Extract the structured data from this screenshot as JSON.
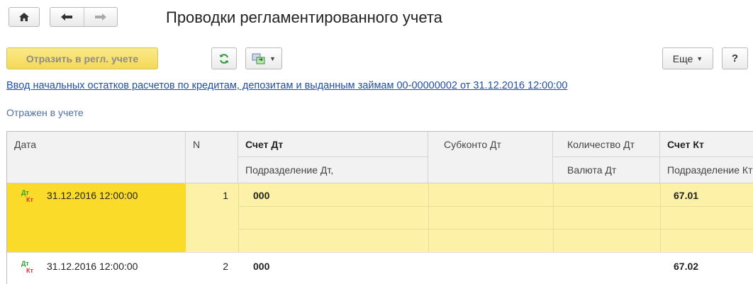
{
  "window": {
    "title": "Проводки регламентированного учета"
  },
  "nav": {
    "home_icon": "home-icon",
    "back_icon": "arrow-left-icon",
    "forward_icon": "arrow-right-icon"
  },
  "toolbar": {
    "reflect_label": "Отразить в регл. учете",
    "refresh_icon": "refresh-icon",
    "structure_icon": "structure-icon",
    "more_label": "Еще",
    "help_label": "?"
  },
  "document": {
    "link_text": "Ввод начальных остатков расчетов по кредитам, депозитам и выданным займам 00-00000002 от 31.12.2016 12:00:00",
    "status_text": "Отражен в учете"
  },
  "table": {
    "headers": {
      "date": "Дата",
      "n": "N",
      "account_dt": "Счет Дт",
      "division_dt": "Подразделение Дт,",
      "subconto_dt": "Субконто Дт",
      "quantity_dt": "Количество Дт",
      "currency_dt": "Валюта Дт",
      "account_kt": "Счет Кт",
      "division_kt": "Подразделение Кт"
    },
    "rows": [
      {
        "icon_dt": "Дт",
        "icon_kt": "Кт",
        "date": "31.12.2016 12:00:00",
        "n": "1",
        "account_dt": "000",
        "account_kt": "67.01",
        "selected": true
      },
      {
        "icon_dt": "Дт",
        "icon_kt": "Кт",
        "date": "31.12.2016 12:00:00",
        "n": "2",
        "account_dt": "000",
        "account_kt": "67.02",
        "selected": false
      }
    ]
  },
  "colors": {
    "primary_button": "#f4d957",
    "selected_row": "#fcf1a6",
    "selected_cell": "#fadb2a",
    "link": "#1f4fa8"
  }
}
